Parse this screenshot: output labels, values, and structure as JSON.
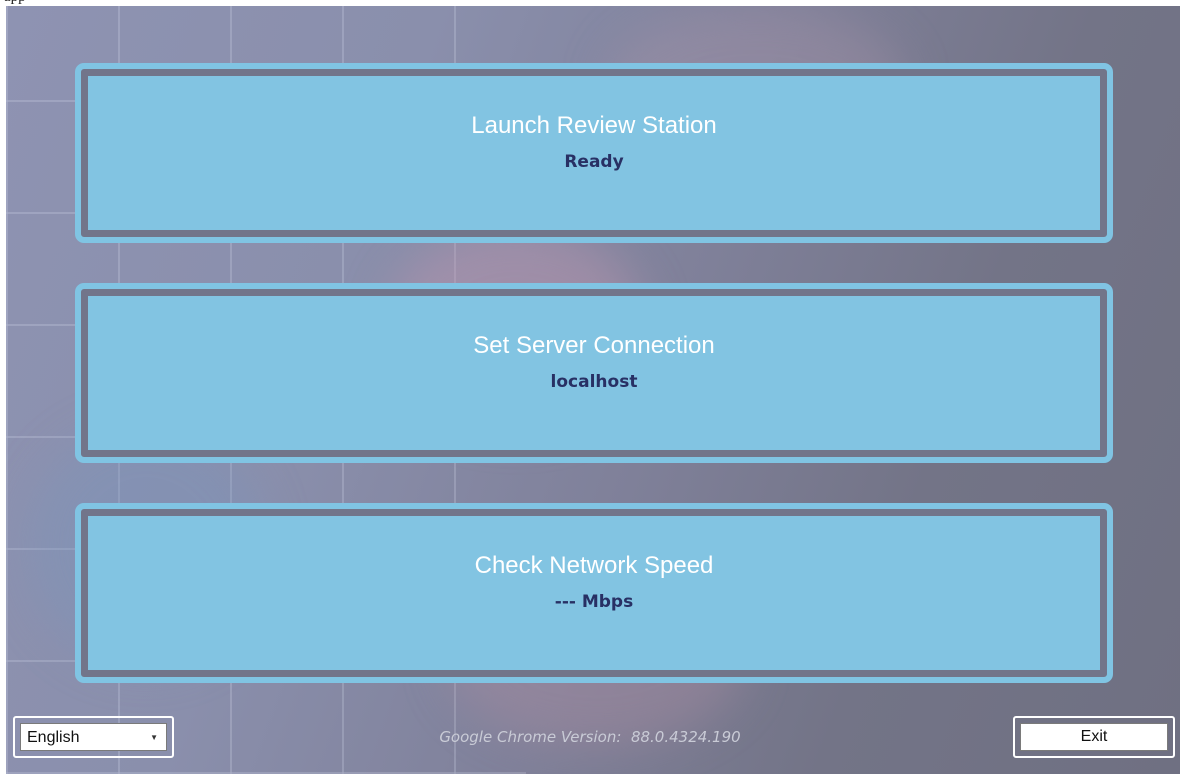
{
  "window": {
    "title": "app"
  },
  "cards": [
    {
      "title": "Launch Review Station",
      "subtitle": "Ready"
    },
    {
      "title": "Set Server Connection",
      "subtitle": "localhost"
    },
    {
      "title": "Check Network Speed",
      "subtitle": "--- Mbps"
    }
  ],
  "footer": {
    "language_selected": "English",
    "language_caret_icon": "chevron-down-icon",
    "version_text": "Google Chrome Version:  88.0.4324.190",
    "exit_label": "Exit"
  },
  "colors": {
    "card_fill": "#82c4e2",
    "card_border": "#80c4e3",
    "subtitle_text": "#283064",
    "backdrop": "#7f8099"
  }
}
